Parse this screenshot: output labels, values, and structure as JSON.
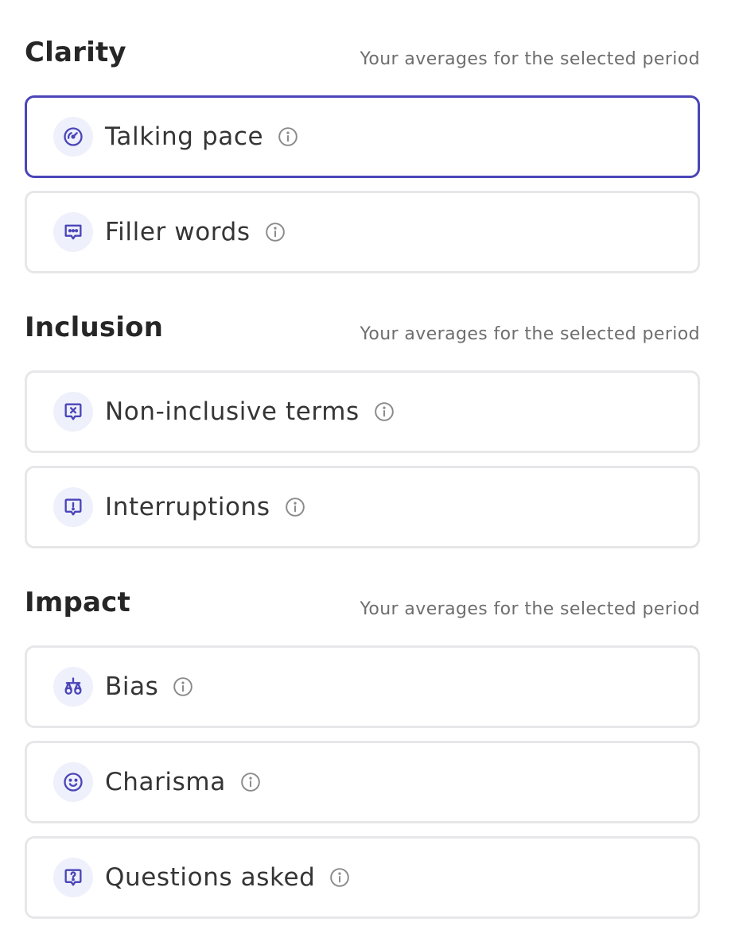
{
  "sections": [
    {
      "title": "Clarity",
      "subtitle": "Your averages for the selected period",
      "cards": [
        {
          "label": "Talking pace",
          "icon": "speedometer-icon",
          "selected": true
        },
        {
          "label": "Filler words",
          "icon": "chat-dots-icon",
          "selected": false
        }
      ]
    },
    {
      "title": "Inclusion",
      "subtitle": "Your averages for the selected period",
      "cards": [
        {
          "label": "Non-inclusive terms",
          "icon": "chat-x-icon",
          "selected": false
        },
        {
          "label": "Interruptions",
          "icon": "chat-alert-icon",
          "selected": false
        }
      ]
    },
    {
      "title": "Impact",
      "subtitle": "Your averages for the selected period",
      "cards": [
        {
          "label": "Bias",
          "icon": "scale-icon",
          "selected": false
        },
        {
          "label": "Charisma",
          "icon": "smile-icon",
          "selected": false
        },
        {
          "label": "Questions asked",
          "icon": "chat-question-icon",
          "selected": false
        }
      ]
    }
  ],
  "colors": {
    "accent": "#4b45b8",
    "icon_bg": "#eef0fb",
    "card_border": "#e7e7ea",
    "info_icon": "#8a8a8a",
    "subtitle": "#6e6e6e"
  }
}
